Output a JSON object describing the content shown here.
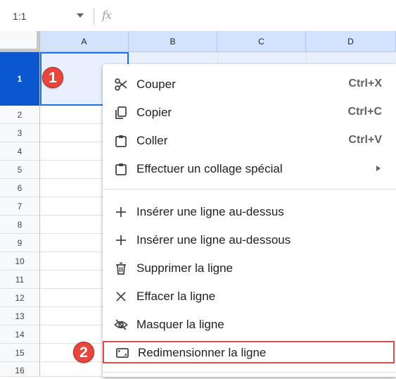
{
  "formula_bar": {
    "name_box": "1:1",
    "fx": "fx"
  },
  "columns": [
    "A",
    "B",
    "C",
    "D"
  ],
  "rows": [
    "1",
    "2",
    "3",
    "4",
    "5",
    "6",
    "7",
    "8",
    "9",
    "10",
    "11",
    "12",
    "13",
    "14",
    "15",
    "16"
  ],
  "badges": {
    "first": "1",
    "second": "2"
  },
  "context_menu": {
    "items": [
      {
        "label": "Couper",
        "shortcut": "Ctrl+X",
        "icon": "scissors-icon"
      },
      {
        "label": "Copier",
        "shortcut": "Ctrl+C",
        "icon": "copy-icon"
      },
      {
        "label": "Coller",
        "shortcut": "Ctrl+V",
        "icon": "clipboard-icon"
      },
      {
        "label": "Effectuer un collage spécial",
        "shortcut": "",
        "icon": "clipboard-icon",
        "submenu_arrow": "▸"
      },
      {
        "label": "Insérer une ligne au-dessus",
        "icon": "plus-icon"
      },
      {
        "label": "Insérer une ligne au-dessous",
        "icon": "plus-icon"
      },
      {
        "label": "Supprimer la ligne",
        "icon": "trash-icon"
      },
      {
        "label": "Effacer la ligne",
        "icon": "close-icon"
      },
      {
        "label": "Masquer la ligne",
        "icon": "eye-off-icon"
      },
      {
        "label": "Redimensionner la ligne",
        "icon": "resize-icon",
        "highlighted": true
      }
    ]
  },
  "colors": {
    "selection": "#0b57d0",
    "header_selected": "#d3e3fd",
    "highlight_border": "#d84c4c",
    "badge": "#e8453c"
  }
}
